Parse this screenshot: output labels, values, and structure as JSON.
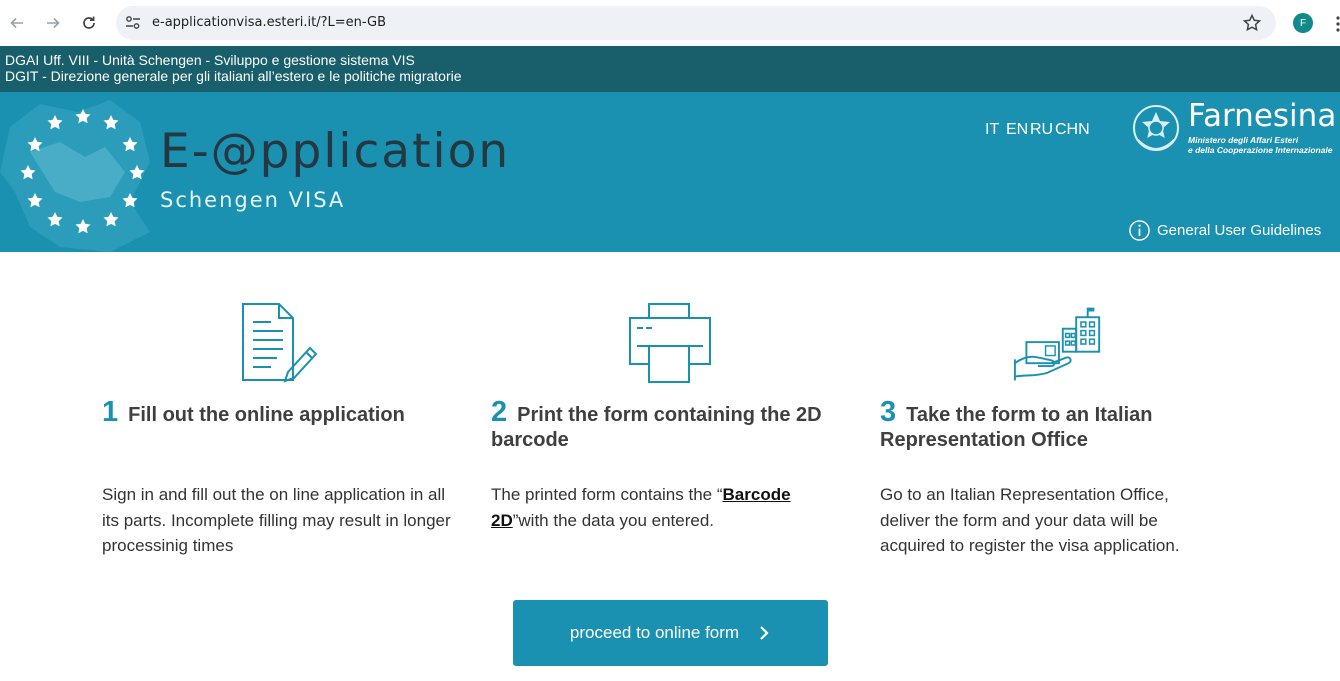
{
  "browser": {
    "url": "e-applicationvisa.esteri.it/?L=en-GB",
    "profile_initial": "F"
  },
  "topbar": {
    "line1": "DGAI Uff. VIII - Unità Schengen - Sviluppo e gestione sistema VIS",
    "line2": "DGIT - Direzione generale per gli italiani all’estero e le politiche migratorie"
  },
  "banner": {
    "title": "E-@pplication",
    "subtitle": "Schengen VISA",
    "languages": [
      "IT",
      "EN",
      "RU",
      "CHN"
    ],
    "logo_name": "Farnesina",
    "logo_line1": "Ministero degli Affari Esteri",
    "logo_line2": "e della Cooperazione Internazionale",
    "guidelines": "General User Guidelines"
  },
  "steps": [
    {
      "number": "1",
      "title": "Fill out the online application",
      "text": "Sign in and fill out the on line application in all its parts. Incomplete filling may result in longer processinig times",
      "icon": "document-pencil-icon"
    },
    {
      "number": "2",
      "title": "Print the form containing the 2D barcode",
      "text_before": "The printed form contains the “",
      "link": "Barcode 2D",
      "text_after": "”with the data you entered.",
      "icon": "printer-icon"
    },
    {
      "number": "3",
      "title": "Take the form to an Italian Representation Office",
      "text": "Go to an Italian Representation Office, deliver the form and your data will be acquired to register the visa application.",
      "icon": "hand-building-icon"
    }
  ],
  "cta": {
    "label": "proceed to online form"
  },
  "colors": {
    "accent": "#1a91b0",
    "topbar": "#185f6b",
    "title_dark": "#253741"
  }
}
